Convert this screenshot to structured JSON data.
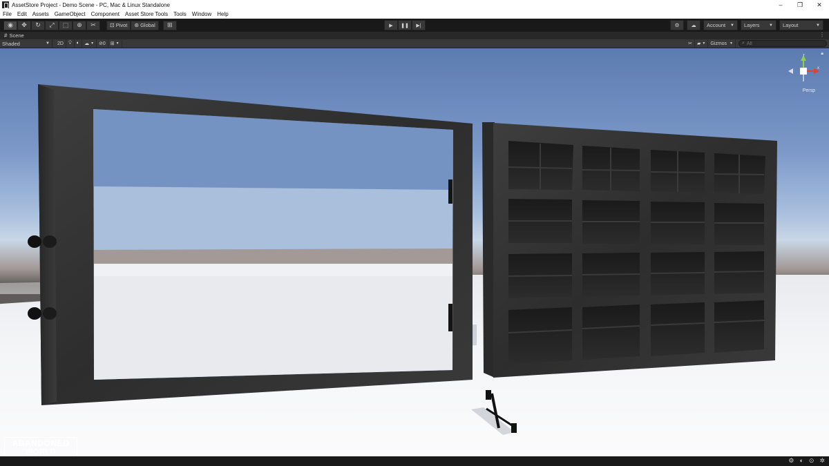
{
  "window": {
    "title": "AssetStore Project - Demo Scene - PC, Mac & Linux Standalone",
    "controls": [
      "–",
      "❐",
      "✕"
    ]
  },
  "menu": [
    "File",
    "Edit",
    "Assets",
    "GameObject",
    "Component",
    "Asset Store Tools",
    "Tools",
    "Window",
    "Help"
  ],
  "toolbar": {
    "tools": [
      "hand-tool-icon",
      "move-tool-icon",
      "rotate-tool-icon",
      "scale-tool-icon",
      "rect-tool-icon",
      "transform-tool-icon",
      "custom-tool-icon"
    ],
    "pivot_label": "Pivot",
    "global_label": "Global",
    "account_label": "Account",
    "layers_label": "Layers",
    "layout_label": "Layout"
  },
  "scene_tab": {
    "label": "Scene"
  },
  "scene_controls": {
    "shading_mode": "Shaded",
    "mode_2d": "2D",
    "hidden_count": "0",
    "gizmos_label": "Gizmos",
    "search_placeholder": "All"
  },
  "view_gizmo": {
    "projection": "Persp",
    "axes": [
      "y",
      "x",
      "z"
    ]
  },
  "watermark": {
    "line1": "ABANDONED",
    "line2": "WORLD"
  },
  "colors": {
    "editor_dark": "#191919",
    "button_bg": "#383838",
    "axis_x": "#e0403a",
    "axis_y": "#8fd23f",
    "axis_z": "#4a7ff0"
  }
}
